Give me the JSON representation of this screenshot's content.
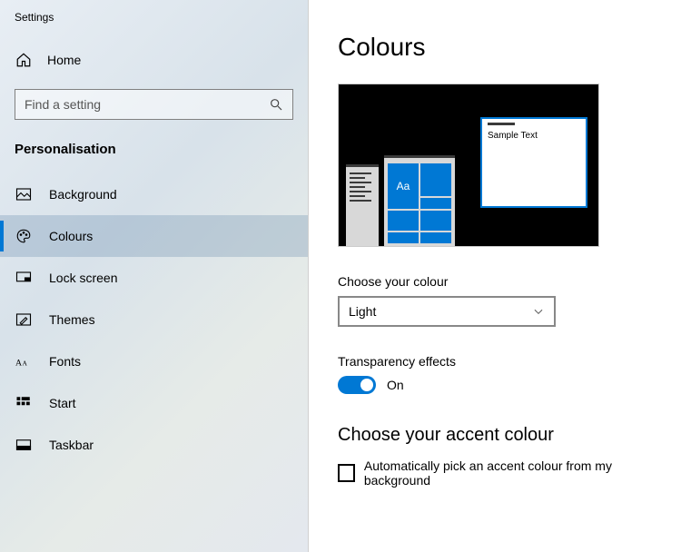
{
  "windowTitle": "Settings",
  "homeLabel": "Home",
  "search": {
    "placeholder": "Find a setting"
  },
  "sectionLabel": "Personalisation",
  "nav": {
    "items": [
      {
        "label": "Background",
        "icon": "image-icon"
      },
      {
        "label": "Colours",
        "icon": "palette-icon",
        "selected": true
      },
      {
        "label": "Lock screen",
        "icon": "monitor-icon"
      },
      {
        "label": "Themes",
        "icon": "pencil-icon"
      },
      {
        "label": "Fonts",
        "icon": "font-icon"
      },
      {
        "label": "Start",
        "icon": "start-icon"
      },
      {
        "label": "Taskbar",
        "icon": "taskbar-icon"
      }
    ]
  },
  "pageTitle": "Colours",
  "preview": {
    "tileLabel": "Aa",
    "sampleText": "Sample Text"
  },
  "chooseColour": {
    "label": "Choose your colour",
    "value": "Light"
  },
  "transparency": {
    "label": "Transparency effects",
    "state": "On"
  },
  "accent": {
    "heading": "Choose your accent colour",
    "autoLabel": "Automatically pick an accent colour from my background"
  }
}
